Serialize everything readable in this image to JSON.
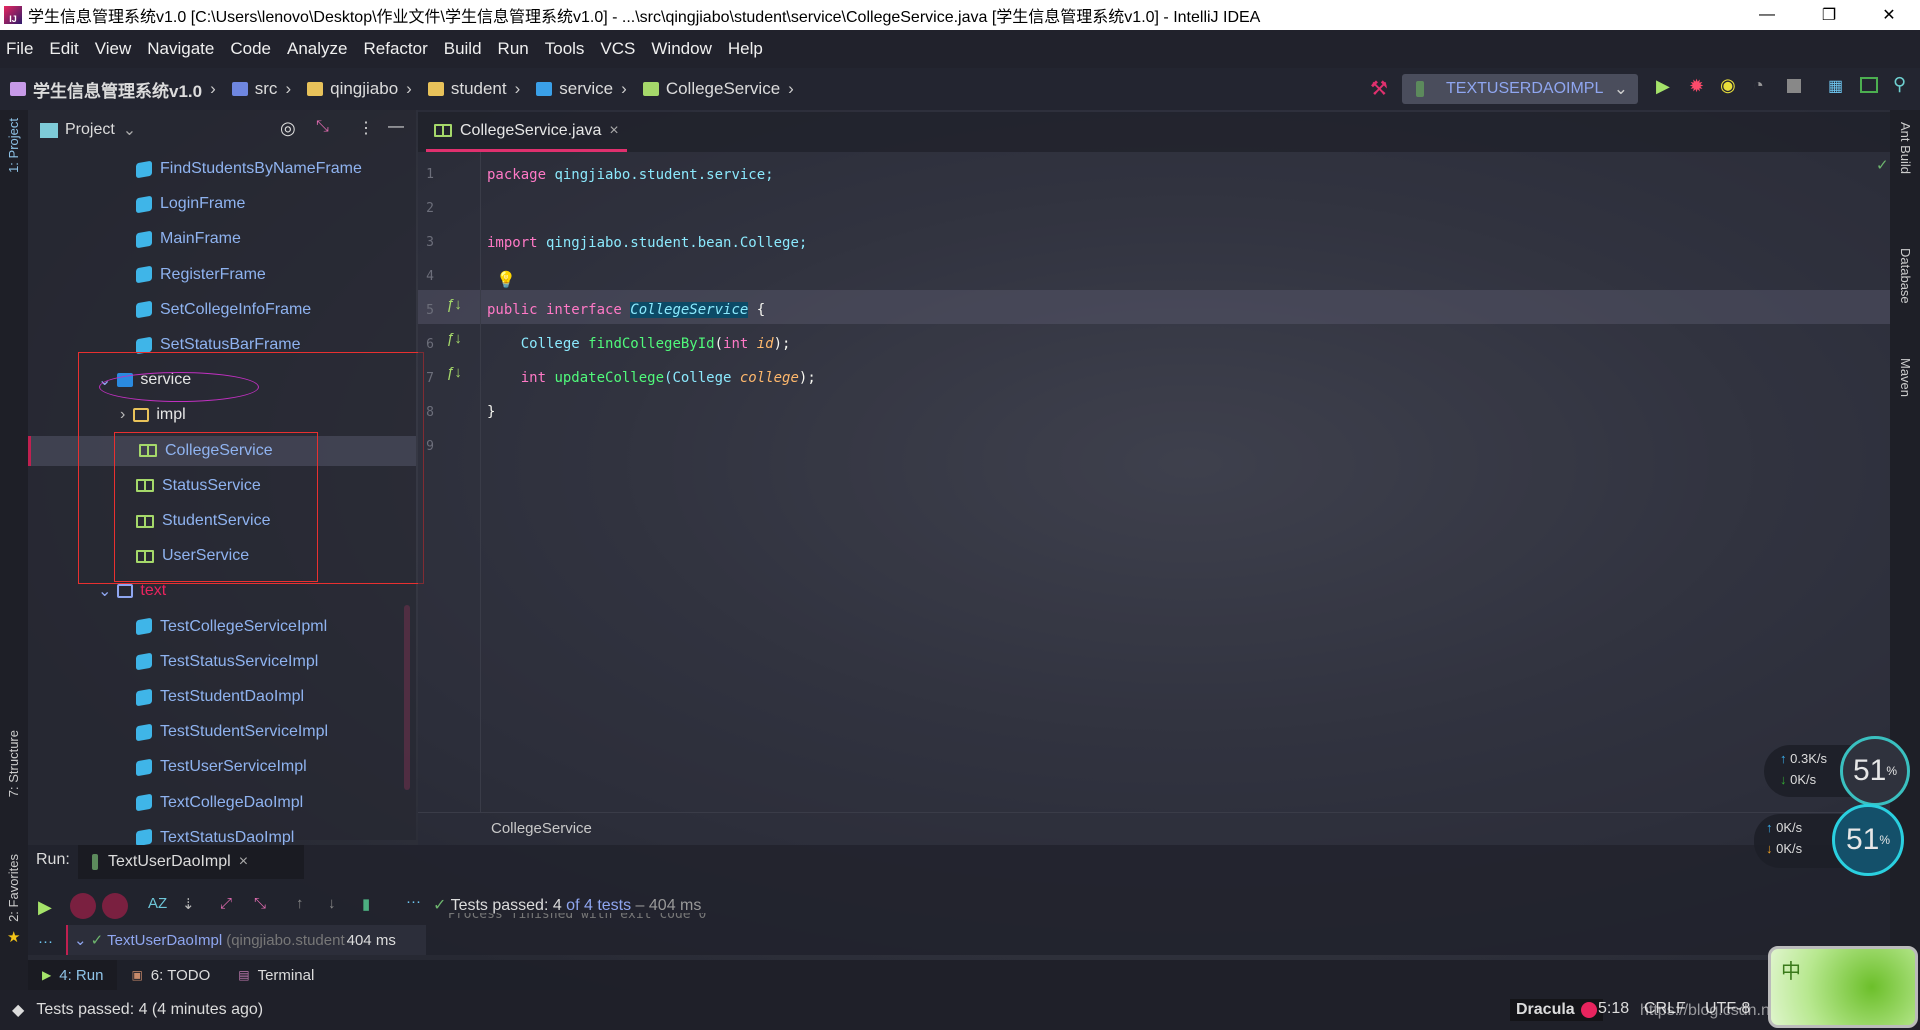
{
  "window": {
    "title": "学生信息管理系统v1.0 [C:\\Users\\lenovo\\Desktop\\作业文件\\学生信息管理系统v1.0] - ...\\src\\qingjiabo\\student\\service\\CollegeService.java [学生信息管理系统v1.0] - IntelliJ IDEA",
    "logo": "IJ",
    "minimize": "—",
    "restore": "❐",
    "close": "✕"
  },
  "menu": [
    "File",
    "Edit",
    "View",
    "Navigate",
    "Code",
    "Analyze",
    "Refactor",
    "Build",
    "Run",
    "Tools",
    "VCS",
    "Window",
    "Help"
  ],
  "breadcrumb": [
    "学生信息管理系统v1.0",
    "src",
    "qingjiabo",
    "student",
    "service",
    "CollegeService"
  ],
  "run_config": {
    "label": "TEXTUSERDAOIMPL"
  },
  "left_strip": {
    "project": "1: Project",
    "structure": "7: Structure",
    "favorites": "2: Favorites"
  },
  "right_strip": {
    "ant": "Ant Build",
    "database": "Database",
    "maven": "Maven"
  },
  "project_panel": {
    "title": "Project",
    "items": [
      {
        "label": "FindStudentsByNameFrame",
        "type": "class"
      },
      {
        "label": "LoginFrame",
        "type": "class"
      },
      {
        "label": "MainFrame",
        "type": "class"
      },
      {
        "label": "RegisterFrame",
        "type": "class"
      },
      {
        "label": "SetCollegeInfoFrame",
        "type": "class"
      },
      {
        "label": "SetStatusBarFrame",
        "type": "class"
      },
      {
        "label": "service",
        "type": "package"
      },
      {
        "label": "impl",
        "type": "folder"
      },
      {
        "label": "CollegeService",
        "type": "interface",
        "selected": true
      },
      {
        "label": "StatusService",
        "type": "interface"
      },
      {
        "label": "StudentService",
        "type": "interface"
      },
      {
        "label": "UserService",
        "type": "interface"
      },
      {
        "label": "text",
        "type": "folder"
      },
      {
        "label": "TestCollegeServiceIpml",
        "type": "test"
      },
      {
        "label": "TestStatusServiceImpl",
        "type": "test"
      },
      {
        "label": "TestStudentDaoImpl",
        "type": "test"
      },
      {
        "label": "TestStudentServiceImpl",
        "type": "test"
      },
      {
        "label": "TestUserServiceImpl",
        "type": "test"
      },
      {
        "label": "TextCollegeDaoImpl",
        "type": "test"
      },
      {
        "label": "TextStatusDaoImpl",
        "type": "test"
      }
    ]
  },
  "editor": {
    "tab": "CollegeService.java",
    "tab_close": "×",
    "line_numbers": [
      "1",
      "2",
      "3",
      "4",
      "5",
      "6",
      "7",
      "8",
      "9"
    ],
    "code": {
      "l1a": "package",
      "l1b": " qingjiabo.student.service;",
      "l3a": "import",
      "l3b": " qingjiabo.student.bean.College;",
      "l5a": "public",
      "l5b": " interface ",
      "l5c": "CollegeService",
      "l5d": " {",
      "l6a": "    College ",
      "l6b": "findCollegeById",
      "l6c": "(",
      "l6d": "int ",
      "l6e": "id",
      "l6f": ");",
      "l7a": "    int ",
      "l7b": "updateCollege",
      "l7c": "(College ",
      "l7d": "college",
      "l7e": ");",
      "l8": "}"
    },
    "breadcrumb": "CollegeService"
  },
  "run": {
    "label": "Run:",
    "tab": "TextUserDaoImpl",
    "tab_close": "×",
    "status_pre": "Tests passed: 4",
    "status_mid": " of 4 tests",
    "status_post": " – 404 ms",
    "tree_item": "TextUserDaoImpl",
    "tree_pkg": "(qingjiabo.student",
    "tree_time": "404 ms",
    "console": "Process finished with exit code 0"
  },
  "tool_tabs": [
    "4: Run",
    "6: TODO",
    "Terminal"
  ],
  "status": {
    "message": "Tests passed: 4 (4 minutes ago)",
    "theme": "Dracula",
    "position": "5:18",
    "line_sep": "CRLF",
    "encoding": "UTF-8",
    "watermark": "https://blog.csdn.net/weixin_44202489"
  },
  "overlay": {
    "gauge1": "51",
    "gauge2": "51",
    "up1": "0.3K/s",
    "down1": "0K/s",
    "up2": "0K/s",
    "down2": "0K/s",
    "ime": "中"
  },
  "colors": {
    "accent": "#e0306e",
    "keyword": "#ff79c6",
    "type": "#8be9fd",
    "function": "#50fa7b",
    "param": "#ffb86c",
    "link": "#8fb3f0"
  }
}
